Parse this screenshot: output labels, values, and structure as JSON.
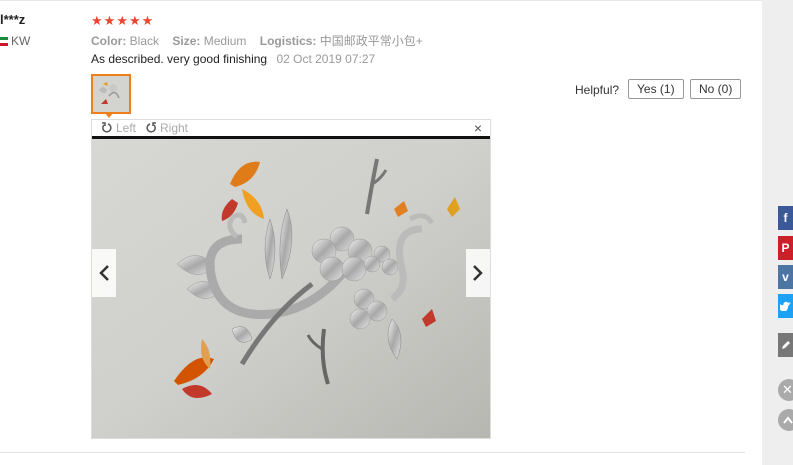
{
  "review": {
    "user": "l***z",
    "country": "KW",
    "rating": 5,
    "attributes": [
      {
        "key": "Color:",
        "value": "Black"
      },
      {
        "key": "Size:",
        "value": "Medium"
      },
      {
        "key": "Logistics:",
        "value": "中国邮政平常小包+"
      }
    ],
    "text": "As described. very good finishing",
    "date": "02 Oct 2019 07:27"
  },
  "helpful": {
    "label": "Helpful?",
    "yes": "Yes (1)",
    "no": "No (0)"
  },
  "viewer": {
    "rotate_left": "Left",
    "rotate_right": "Right",
    "close": "×"
  },
  "colors": {
    "star": "#f0432f",
    "thumb_border": "#f07f1b",
    "facebook": "#3b5998",
    "pinterest": "#cb2027",
    "vk": "#4c75a3",
    "twitter": "#1da1f2",
    "edit": "#777777"
  },
  "share_icons": [
    "facebook-icon",
    "pinterest-icon",
    "vk-icon",
    "twitter-icon",
    "pencil-icon"
  ]
}
